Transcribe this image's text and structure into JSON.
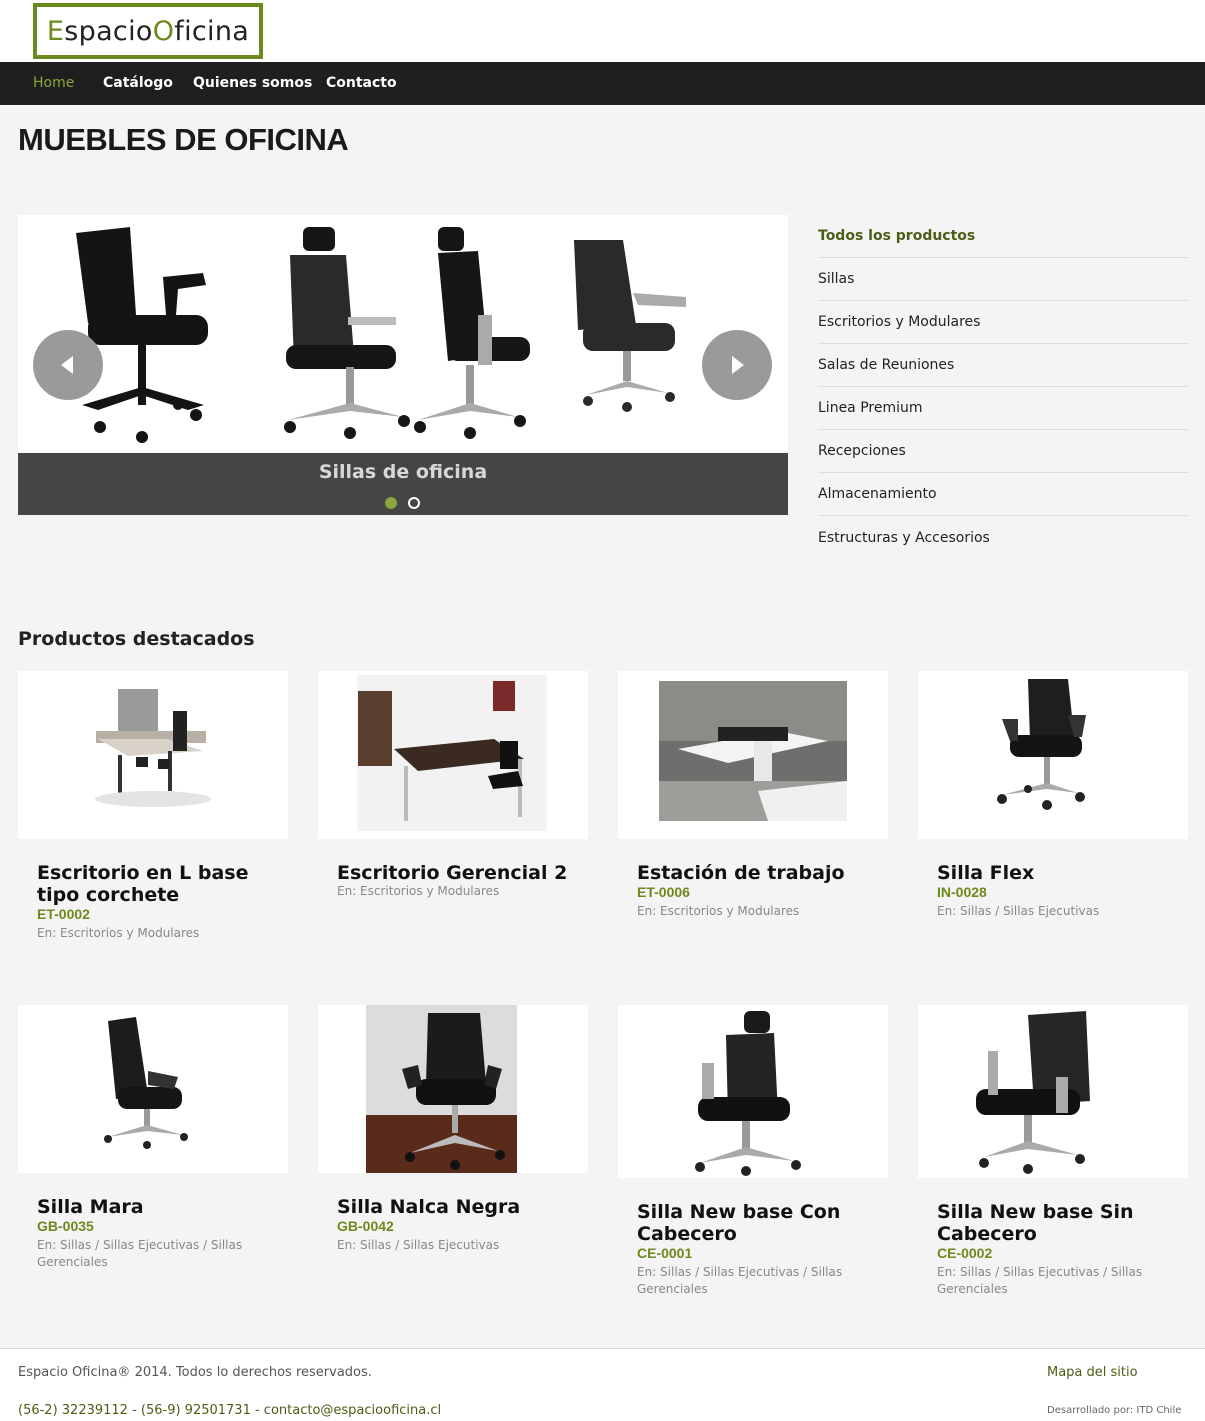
{
  "logo": {
    "part1": "E",
    "part2": "spacio",
    "part3": "O",
    "part4": "ficina"
  },
  "nav": {
    "items": [
      "Home",
      "Catálogo",
      "Quienes somos",
      "Contacto"
    ]
  },
  "page_title": "MUEBLES DE OFICINA",
  "slider": {
    "caption": "Sillas de oficina",
    "active_slide": 1,
    "slide_count": 2
  },
  "categories": [
    "Todos los productos",
    "Sillas",
    "Escritorios y Modulares",
    "Salas de Reuniones",
    "Linea Premium",
    "Recepciones",
    "Almacenamiento",
    "Estructuras y Accesorios"
  ],
  "featured": {
    "title": "Productos destacados",
    "products": [
      {
        "name": "Escritorio en L base tipo corchete",
        "code": "ET-0002",
        "category": "En: Escritorios y Modulares"
      },
      {
        "name": "Escritorio Gerencial 2",
        "code": "",
        "category": "En: Escritorios y Modulares"
      },
      {
        "name": "Estación de trabajo",
        "code": "ET-0006",
        "category": "En: Escritorios y Modulares"
      },
      {
        "name": "Silla Flex",
        "code": "IN-0028",
        "category": "En: Sillas / Sillas Ejecutivas"
      },
      {
        "name": "Silla Mara",
        "code": "GB-0035",
        "category": "En: Sillas / Sillas Ejecutivas / Sillas Gerenciales"
      },
      {
        "name": "Silla Nalca Negra",
        "code": "GB-0042",
        "category": "En: Sillas / Sillas Ejecutivas"
      },
      {
        "name": "Silla New base Con Cabecero",
        "code": "CE-0001",
        "category": "En: Sillas / Sillas Ejecutivas / Sillas Gerenciales"
      },
      {
        "name": "Silla New base Sin Cabecero",
        "code": "CE-0002",
        "category": "En: Sillas / Sillas Ejecutivas / Sillas Gerenciales"
      }
    ]
  },
  "footer": {
    "copyright": "Espacio Oficina® 2014. Todos lo derechos reservados.",
    "contact": "(56-2) 32239112 - (56-9) 92501731 - contacto@espaciooficina.cl",
    "sitemap": "Mapa del sitio",
    "developed_by": "Desarrollado por: ITD Chile"
  },
  "colors": {
    "accent": "#6b8a1d",
    "nav_bg": "#1f1f1f",
    "caption_bg": "#454545"
  }
}
